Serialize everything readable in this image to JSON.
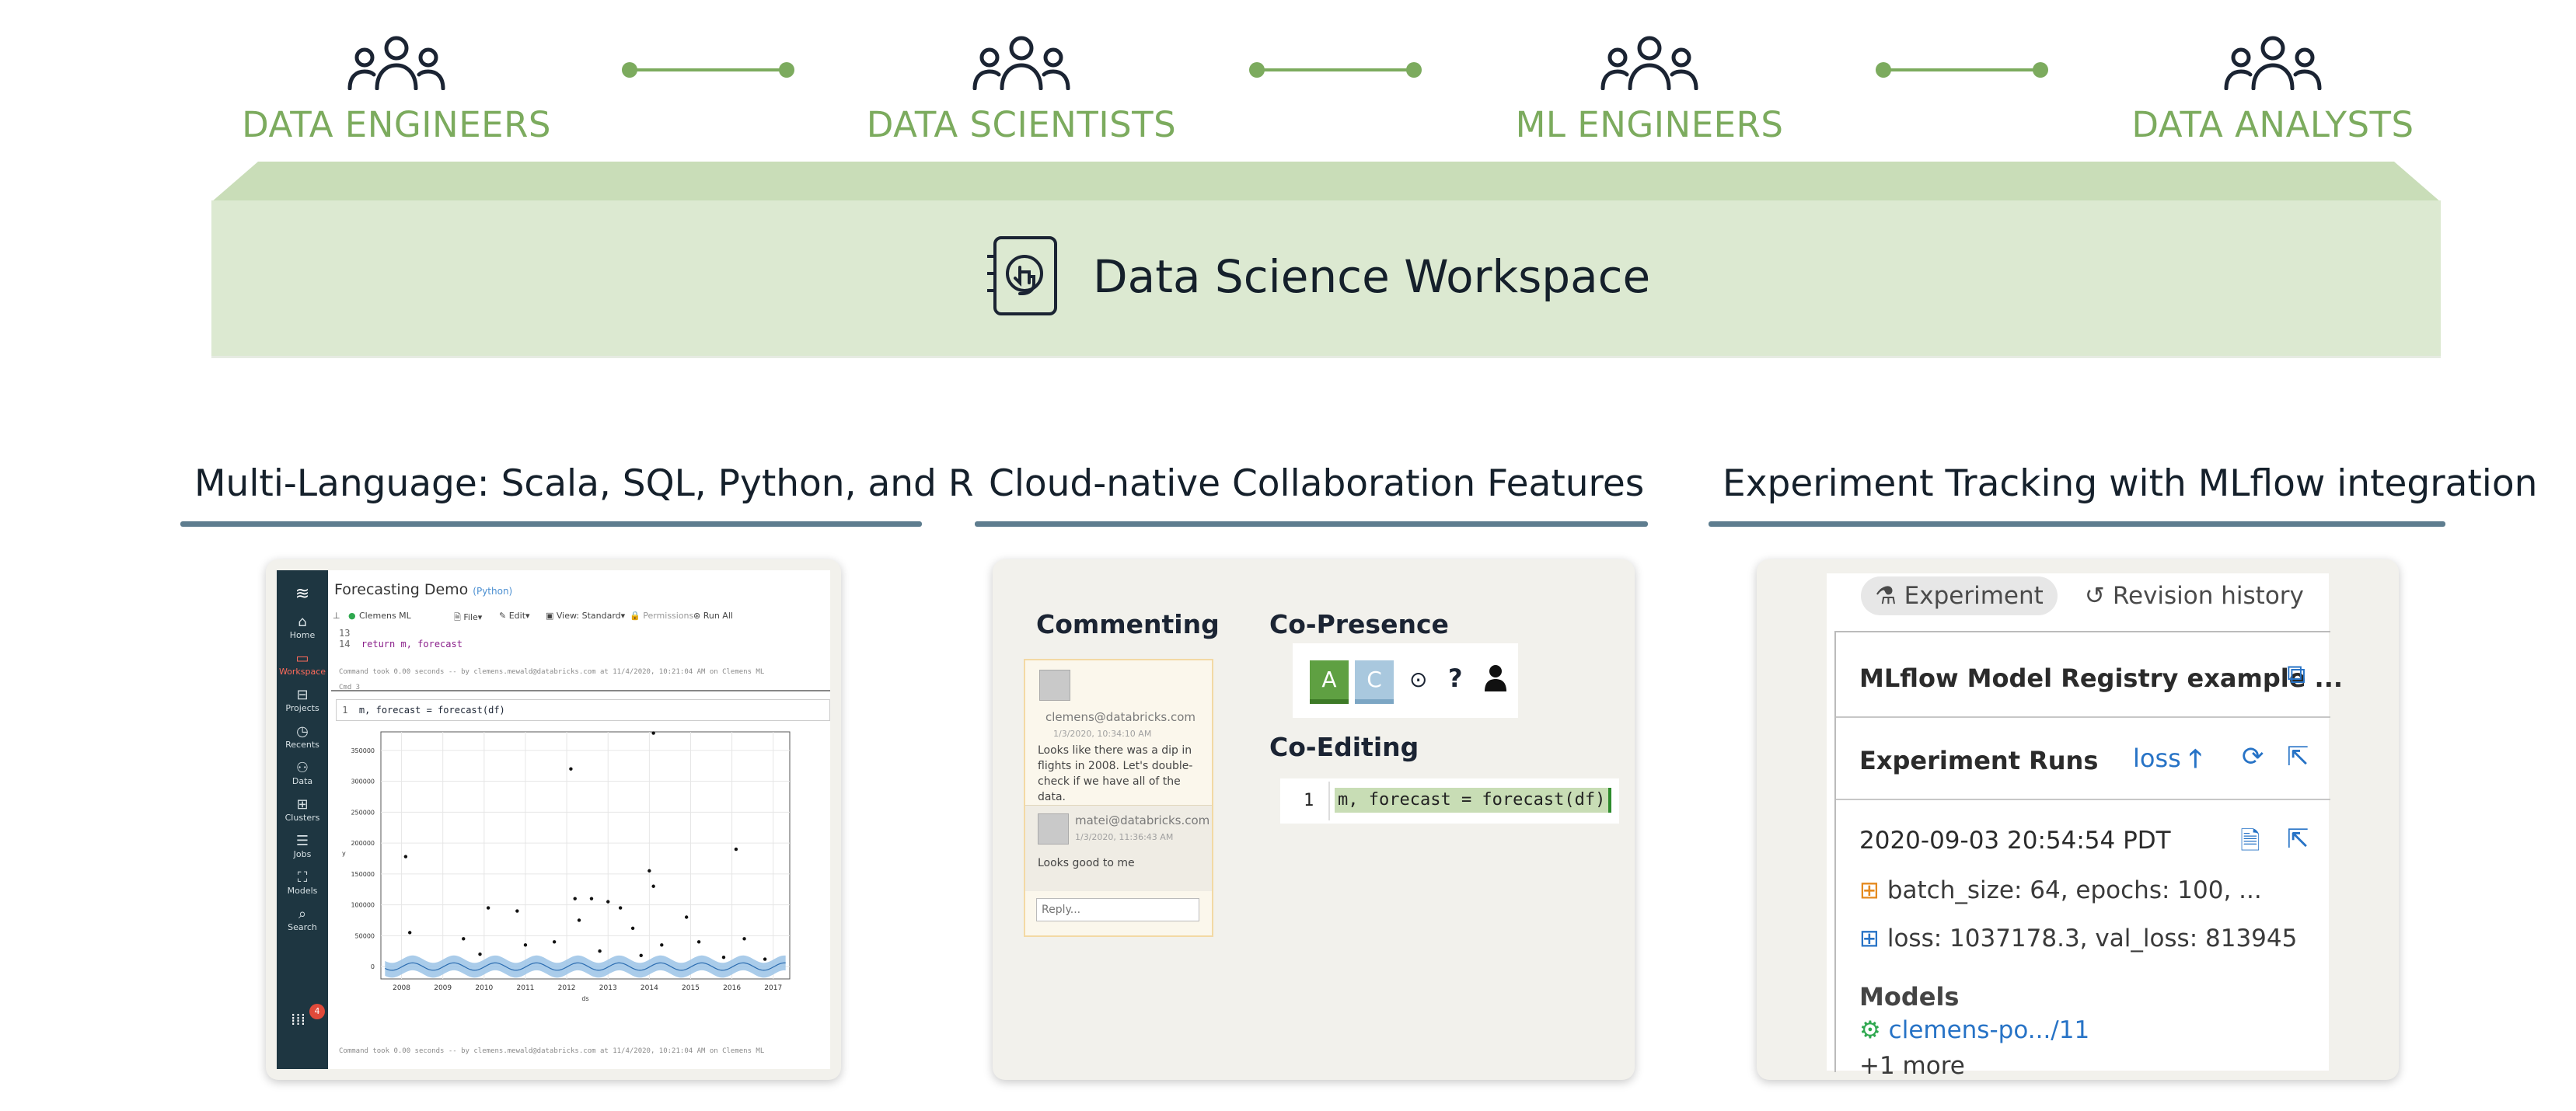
{
  "personas": [
    {
      "label": "DATA ENGINEERS",
      "icon": "people-group-icon"
    },
    {
      "label": "DATA SCIENTISTS",
      "icon": "people-group-icon"
    },
    {
      "label": "ML ENGINEERS",
      "icon": "people-group-icon"
    },
    {
      "label": "DATA ANALYSTS",
      "icon": "people-group-icon"
    }
  ],
  "workspace": {
    "title": "Data Science Workspace",
    "icon": "workspace-touch-icon"
  },
  "colors": {
    "accent_green": "#7cab5e",
    "banner_bg": "#dce9d1",
    "rule": "#5e7d8f",
    "navy": "#1b2433"
  },
  "sections": {
    "notebook_title": "Multi-Language: Scala, SQL, Python, and R",
    "collab_title": "Cloud-native Collaboration Features",
    "mlflow_title": "Experiment Tracking with MLflow integration"
  },
  "notebook": {
    "title": "Forecasting Demo",
    "lang": "(Python)",
    "cluster": "Clemens ML",
    "menu": [
      "File",
      "Edit",
      "View: Standard",
      "Permissions",
      "Run All"
    ],
    "sidebar": [
      "Home",
      "Workspace",
      "Projects",
      "Recents",
      "Data",
      "Clusters",
      "Jobs",
      "Models",
      "Search"
    ],
    "badge": "4",
    "code_lines": [
      {
        "n": "13",
        "t": ""
      },
      {
        "n": "14",
        "t": "return m, forecast"
      }
    ],
    "cmd_footer_1": "Command took 0.00 seconds -- by clemens.mewald@databricks.com at 11/4/2020, 10:21:04 AM on Clemens ML",
    "cmd_label": "Cmd 3",
    "cell_line": {
      "n": "1",
      "t": "m, forecast = forecast(df)"
    },
    "cmd_footer_2": "Command took 0.00 seconds -- by clemens.mewald@databricks.com at 11/4/2020, 10:21:04 AM on Clemens ML",
    "y_axis_title": "y",
    "x_axis_title": "ds"
  },
  "chart_data": {
    "type": "scatter",
    "title": "",
    "xlabel": "ds",
    "ylabel": "y",
    "x_ticks": [
      "2008",
      "2009",
      "2010",
      "2011",
      "2012",
      "2013",
      "2014",
      "2015",
      "2016",
      "2017"
    ],
    "y_ticks": [
      0,
      50000,
      100000,
      150000,
      200000,
      250000,
      300000,
      350000
    ],
    "xlim": [
      2007.5,
      2017.4
    ],
    "ylim": [
      -20000,
      380000
    ],
    "grid": true,
    "series": [
      {
        "values": [
          [
            2008.1,
            178000
          ],
          [
            2012.1,
            320000
          ],
          [
            2014.1,
            378000
          ],
          [
            2016.1,
            190000
          ],
          [
            2014.0,
            155000
          ],
          [
            2014.1,
            130000
          ],
          [
            2012.2,
            110000
          ],
          [
            2012.6,
            110000
          ],
          [
            2013.0,
            105000
          ],
          [
            2013.3,
            95000
          ],
          [
            2010.1,
            95000
          ],
          [
            2010.8,
            90000
          ],
          [
            2014.9,
            80000
          ],
          [
            2012.3,
            75000
          ],
          [
            2013.6,
            62000
          ],
          [
            2008.2,
            55000
          ],
          [
            2009.5,
            45000
          ],
          [
            2011.7,
            40000
          ],
          [
            2015.2,
            40000
          ],
          [
            2016.3,
            45000
          ],
          [
            2011.0,
            35000
          ],
          [
            2014.3,
            35000
          ],
          [
            2009.9,
            20000
          ],
          [
            2013.8,
            18000
          ],
          [
            2012.8,
            25000
          ],
          [
            2015.8,
            15000
          ],
          [
            2016.8,
            12000
          ]
        ]
      }
    ]
  },
  "collab": {
    "commenting": "Commenting",
    "co_presence": "Co-Presence",
    "co_editing": "Co-Editing",
    "comment1": {
      "email": "clemens@databricks.com",
      "date": "1/3/2020, 10:34:10 AM",
      "text": "Looks like there was a dip in flights in 2008. Let's double-check if we have all of the data."
    },
    "comment2": {
      "email": "matei@databricks.com",
      "date": "1/3/2020, 11:36:43 AM",
      "text": "Looks good to me"
    },
    "reply_placeholder": "Reply...",
    "presence_a": "A",
    "presence_c": "C",
    "question": "?",
    "code_line_no": "1",
    "code": "m, forecast = forecast(df)"
  },
  "mlflow": {
    "tab_experiment": "Experiment",
    "tab_revision": "Revision history",
    "model_name": "MLflow Model Registry example ...",
    "experiment_runs": "Experiment Runs",
    "sort_metric": "loss",
    "run_time": "2020-09-03 20:54:54 PDT",
    "params": "batch_size: 64, epochs: 100, ...",
    "metrics": "loss: 1037178.3, val_loss: 813945",
    "models_label": "Models",
    "model_link": "clemens-po.../11",
    "more": "+1 more"
  }
}
